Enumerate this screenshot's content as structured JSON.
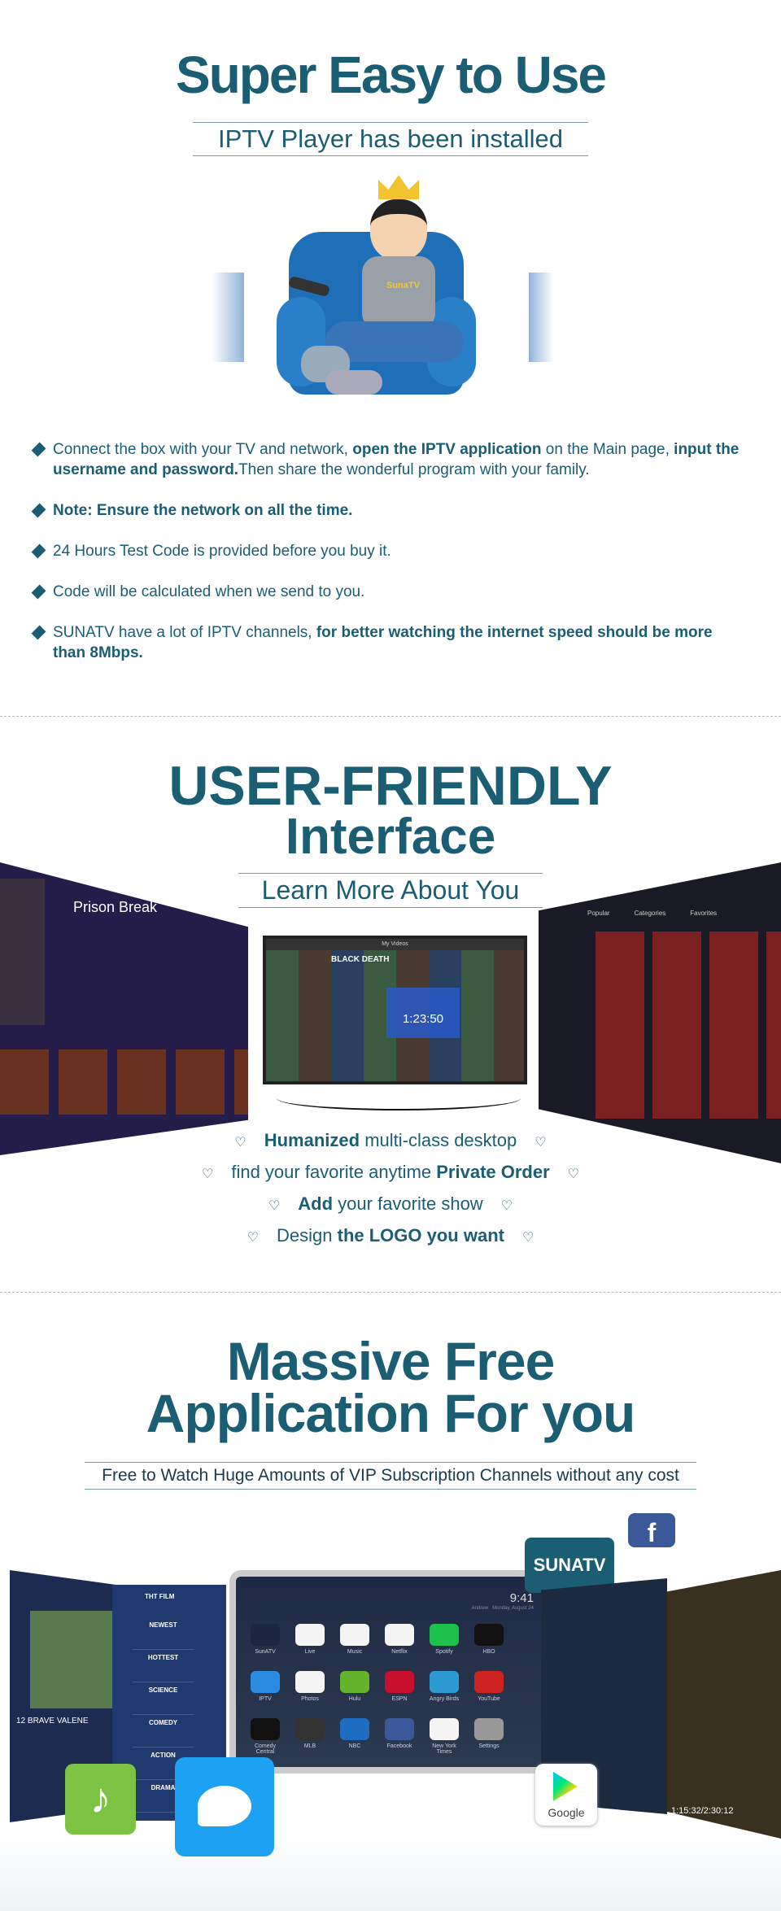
{
  "section1": {
    "title": "Super Easy to Use",
    "subtitle": "IPTV Player has been installed",
    "mascot_badge": "SunaTV",
    "bullets": [
      {
        "parts": [
          {
            "t": "Connect the box with your TV and network, ",
            "b": false
          },
          {
            "t": "open the IPTV application",
            "b": true
          },
          {
            "t": " on the Main page, ",
            "b": false
          },
          {
            "t": "input the username and password.",
            "b": true
          },
          {
            "t": "Then share the wonderful program with your family.",
            "b": false
          }
        ]
      },
      {
        "parts": [
          {
            "t": "Note: Ensure the network on all the time.",
            "b": true
          }
        ]
      },
      {
        "parts": [
          {
            "t": "24 Hours Test Code is provided before you buy it.",
            "b": false
          }
        ]
      },
      {
        "parts": [
          {
            "t": "Code will be calculated when we send to you.",
            "b": false
          }
        ]
      },
      {
        "parts": [
          {
            "t": "SUNATV have a lot of IPTV channels, ",
            "b": false
          },
          {
            "t": "for better watching the internet speed should be more than 8Mbps.",
            "b": true
          }
        ]
      }
    ]
  },
  "section2": {
    "title_line1": "USER-FRIENDLY",
    "title_line2": "Interface",
    "subtitle": "Learn More About You",
    "left_screen_title": "Prison Break",
    "center_screen_title": "My Videos",
    "center_screen_time": "1:23:50",
    "center_screen_movie": "BLACK DEATH",
    "right_screen_tabs": [
      "Popular",
      "Categories",
      "Favorites"
    ],
    "features": [
      [
        {
          "t": "Humanized",
          "b": true
        },
        {
          "t": " multi-class desktop",
          "b": false
        }
      ],
      [
        {
          "t": "find your favorite anytime ",
          "b": false
        },
        {
          "t": "Private Order",
          "b": true
        }
      ],
      [
        {
          "t": "Add",
          "b": true
        },
        {
          "t": " your favorite show",
          "b": false
        }
      ],
      [
        {
          "t": "Design ",
          "b": false
        },
        {
          "t": "the LOGO you want",
          "b": true
        }
      ]
    ]
  },
  "section3": {
    "title_line1": "Massive Free",
    "title_line2": "Application For you",
    "subtitle": "Free to Watch Huge Amounts of VIP Subscription Channels without any cost",
    "brand_badge": "SUNATV",
    "tv_time": "9:41",
    "tv_user": "Andrew",
    "tv_date": "Monday, August 24",
    "left_menu_title": "THT FILM",
    "left_menu": [
      "NEWEST",
      "HOTTEST",
      "SCIENCE",
      "COMEDY",
      "ACTION",
      "DRAMA"
    ],
    "left_movie": "12  BRAVE VALENE",
    "right_timecode": "1:15:32/2:30:12",
    "google_label": "Google",
    "apps": [
      {
        "name": "SunATV",
        "color": "#1a2540"
      },
      {
        "name": "Live",
        "color": "#f4f4f4"
      },
      {
        "name": "Music",
        "color": "#f4f4f4"
      },
      {
        "name": "Netflix",
        "color": "#f4f4f4"
      },
      {
        "name": "Spotify",
        "color": "#1ec24b"
      },
      {
        "name": "HBO",
        "color": "#111111"
      },
      {
        "name": "IPTV",
        "color": "#2a8be0"
      },
      {
        "name": "Photos",
        "color": "#f4f4f4"
      },
      {
        "name": "Hulu",
        "color": "#66b32e"
      },
      {
        "name": "ESPN",
        "color": "#c8102e"
      },
      {
        "name": "Angry Birds",
        "color": "#2a9ad0"
      },
      {
        "name": "YouTube",
        "color": "#cc2222"
      },
      {
        "name": "Comedy Central",
        "color": "#111111"
      },
      {
        "name": "MLB",
        "color": "#333333"
      },
      {
        "name": "NBC",
        "color": "#1c6cc0"
      },
      {
        "name": "Facebook",
        "color": "#3b5998"
      },
      {
        "name": "New York Times",
        "color": "#f4f4f4"
      },
      {
        "name": "Settings",
        "color": "#999999"
      }
    ]
  },
  "colors": {
    "primary": "#1b5e73",
    "facebook": "#3b5998",
    "twitter": "#1da1f2",
    "music": "#7cc243"
  }
}
